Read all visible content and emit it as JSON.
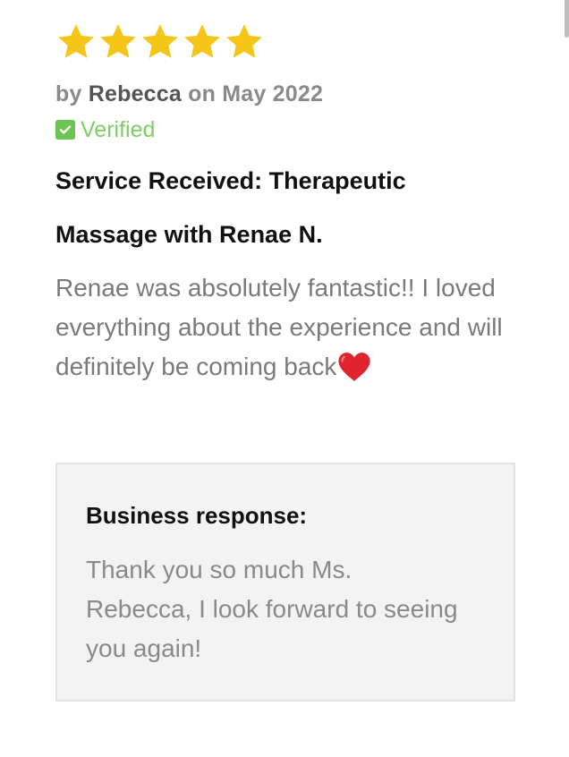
{
  "review": {
    "rating": 5,
    "rating_max": 5,
    "star_color": "#F5C518",
    "by_prefix": "by",
    "author": "Rebecca",
    "date_prefix": "on",
    "date": "May 2022",
    "verified_label": "Verified",
    "verified_color": "#6CC551",
    "service_title": "Service Received: Therapeutic Massage with Renae N.",
    "body": "Renae was absolutely fantastic!! I loved everything about the experience and will definitely be coming back",
    "body_trailing_icon": "red-heart-icon"
  },
  "business_response": {
    "heading": "Business response:",
    "text": "Thank you so much Ms. Rebecca, I look forward to seeing you again!"
  }
}
